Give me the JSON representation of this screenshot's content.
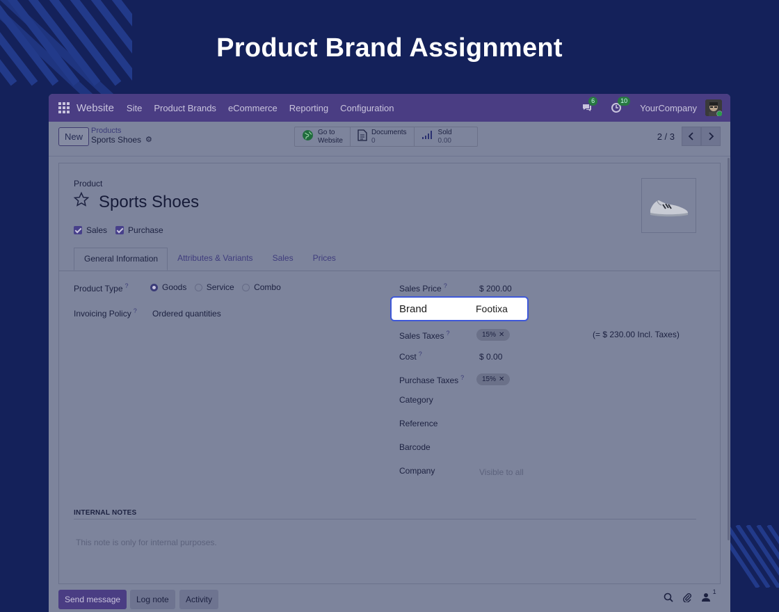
{
  "heading": "Product Brand Assignment",
  "navbar": {
    "app": "Website",
    "items": [
      "Site",
      "Product Brands",
      "eCommerce",
      "Reporting",
      "Configuration"
    ],
    "messages_badge": "6",
    "activity_badge": "10",
    "company": "YourCompany"
  },
  "control_panel": {
    "new_label": "New",
    "breadcrumb_parent": "Products",
    "breadcrumb_current": "Sports Shoes",
    "smart_buttons": [
      {
        "line1": "Go to",
        "line2": "Website",
        "icon": "globe-icon"
      },
      {
        "line1": "Documents",
        "line2": "0",
        "icon": "document-icon"
      },
      {
        "line1": "Sold",
        "line2": "0.00",
        "icon": "bar-chart-icon"
      }
    ],
    "pager": "2 / 3"
  },
  "form": {
    "product_label": "Product",
    "name": "Sports Shoes",
    "checkboxes": [
      {
        "label": "Sales",
        "checked": true
      },
      {
        "label": "Purchase",
        "checked": true
      }
    ],
    "tabs": [
      "General Information",
      "Attributes & Variants",
      "Sales",
      "Prices"
    ],
    "active_tab": "General Information",
    "left": {
      "product_type_label": "Product Type",
      "product_type_options": [
        "Goods",
        "Service",
        "Combo"
      ],
      "product_type_selected": "Goods",
      "invoicing_policy_label": "Invoicing Policy",
      "invoicing_policy_value": "Ordered quantities"
    },
    "right": {
      "sales_price_label": "Sales Price",
      "sales_price_value": "$ 200.00",
      "brand_label": "Brand",
      "brand_value": "Footixa",
      "sales_taxes_label": "Sales Taxes",
      "sales_taxes_tag": "15%",
      "sales_taxes_incl": "(= $ 230.00 Incl. Taxes)",
      "cost_label": "Cost",
      "cost_value": "$ 0.00",
      "purchase_taxes_label": "Purchase Taxes",
      "purchase_taxes_tag": "15%",
      "category_label": "Category",
      "reference_label": "Reference",
      "barcode_label": "Barcode",
      "company_label": "Company",
      "company_placeholder": "Visible to all"
    },
    "help_mark": "?",
    "internal_notes_heading": "INTERNAL NOTES",
    "internal_notes_placeholder": "This note is only for internal purposes."
  },
  "chatter": {
    "send_message": "Send message",
    "log_note": "Log note",
    "activity": "Activity",
    "followers_count": "1"
  },
  "colors": {
    "page_bg": "#14215a",
    "highlight_border": "#3e58d8",
    "navbar": "#4a3d83"
  }
}
